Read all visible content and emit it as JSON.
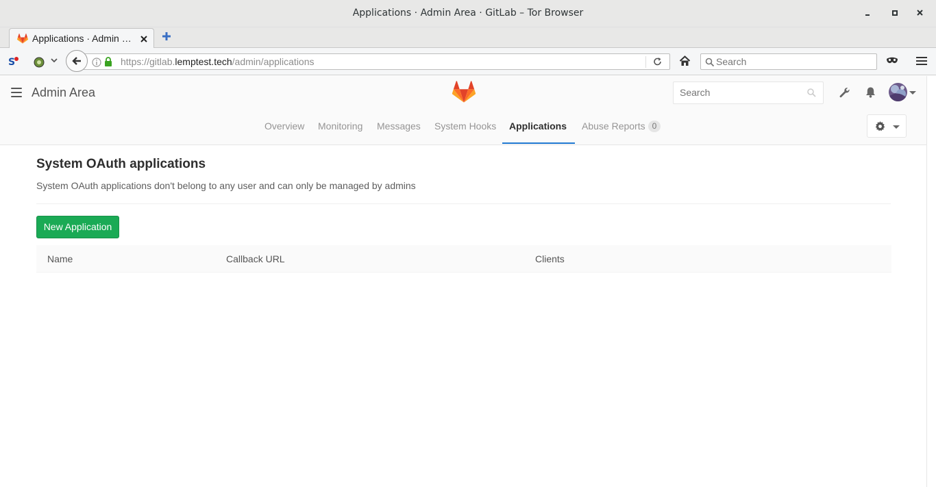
{
  "window": {
    "title": "Applications · Admin Area · GitLab – Tor Browser",
    "minimize": "‒",
    "maximize": "▫",
    "close": "✕"
  },
  "tab": {
    "title": "Applications · Admin …",
    "close": "✕"
  },
  "navbar": {
    "url_scheme": "https://gitlab.",
    "url_host": "lemptest.tech",
    "url_path": "/admin/applications",
    "search_placeholder": "Search"
  },
  "header": {
    "title": "Admin Area",
    "search_placeholder": "Search"
  },
  "subnav": {
    "items": [
      {
        "label": "Overview"
      },
      {
        "label": "Monitoring"
      },
      {
        "label": "Messages"
      },
      {
        "label": "System Hooks"
      },
      {
        "label": "Applications"
      },
      {
        "label": "Abuse Reports",
        "badge": "0"
      }
    ],
    "active": "Applications"
  },
  "main": {
    "title": "System OAuth applications",
    "description": "System OAuth applications don't belong to any user and can only be managed by admins",
    "new_button": "New Application",
    "table": {
      "columns": [
        "Name",
        "Callback URL",
        "Clients"
      ]
    }
  },
  "colors": {
    "accent_green": "#1aaa55",
    "active_underline": "#1f78d1",
    "gitlab_orange": "#fc6d26"
  }
}
